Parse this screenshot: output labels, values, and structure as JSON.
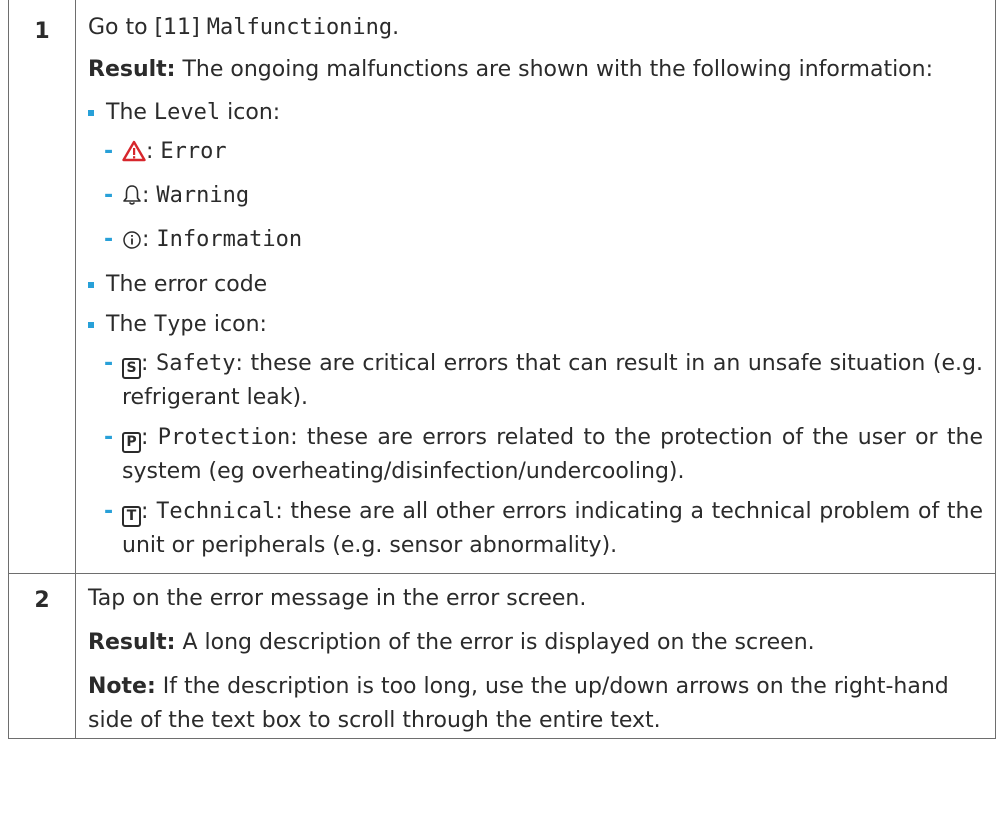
{
  "step1": {
    "number": "1",
    "go_to_prefix": "Go to [11] ",
    "go_to_target": "Malfunctioning",
    "go_to_suffix": ".",
    "result_label": "Result:",
    "result_text": " The ongoing malfunctions are shown with the following information:",
    "level_prefix": "The ",
    "level_word": "Level",
    "level_suffix": " icon:",
    "levels": [
      {
        "icon": "warning-triangle-icon",
        "label": "Error"
      },
      {
        "icon": "bell-icon",
        "label": "Warning"
      },
      {
        "icon": "info-circle-icon",
        "label": "Information"
      }
    ],
    "error_code": "The error code",
    "type_prefix": "The ",
    "type_word": "Type",
    "type_suffix": " icon:",
    "types": [
      {
        "badge": "S",
        "label": "Safety",
        "text": ": these are critical errors that can result in an unsafe situation (e.g. refrigerant leak)."
      },
      {
        "badge": "P",
        "label": "Protection",
        "text": ": these are errors related to the protection of the user or the system (eg overheating/disinfection/undercooling)."
      },
      {
        "badge": "T",
        "label": "Technical",
        "text": ": these are all other errors indicating a technical problem of the unit or peripherals (e.g. sensor abnormality)."
      }
    ]
  },
  "step2": {
    "number": "2",
    "text": "Tap on the error message in the error screen.",
    "result_label": "Result:",
    "result_text": " A long description of the error is displayed on the screen.",
    "note_label": "Note:",
    "note_text": " If the description is too long, use the up/down arrows on the right-hand side of the text box to scroll through the entire text."
  },
  "colors": {
    "accent": "#28a0d8",
    "error": "#d7262c",
    "text": "#2b2b2b"
  }
}
